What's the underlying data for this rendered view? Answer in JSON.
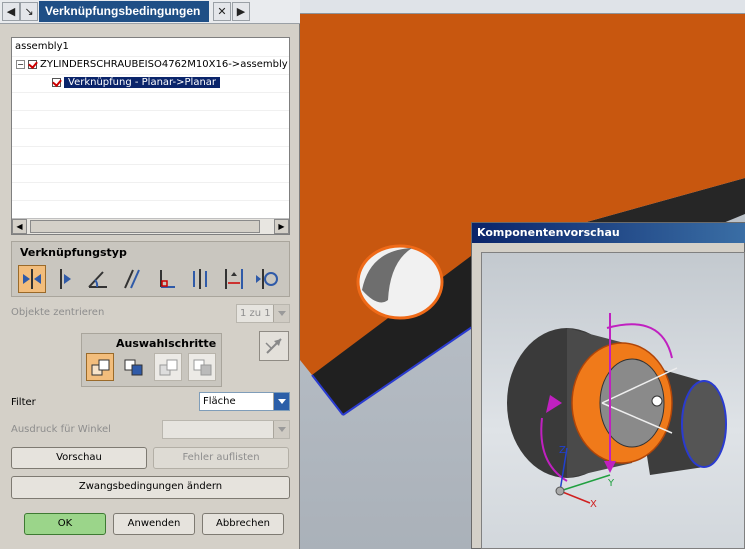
{
  "dialog": {
    "title": "Verknüpfungsbedingungen",
    "tree": {
      "root": "assembly1",
      "child": "ZYLINDERSCHRAUBEISO4762M10X16->assembly",
      "selected": "Verknüpfung - Planar->Planar"
    },
    "constraint_type_label": "Verknüpfungstyp",
    "center_objects_label": "Objekte zentrieren",
    "center_objects_value": "1 zu 1",
    "selection_steps_label": "Auswahlschritte",
    "filter_label": "Filter",
    "filter_value": "Fläche",
    "angle_expr_label": "Ausdruck für Winkel",
    "buttons": {
      "preview": "Vorschau",
      "list_errors": "Fehler auflisten",
      "change_constraints": "Zwangsbedingungen ändern",
      "ok": "OK",
      "apply": "Anwenden",
      "cancel": "Abbrechen"
    }
  },
  "preview_window": {
    "title": "Komponentenvorschau",
    "axis_labels": [
      "Z",
      "Y",
      "X"
    ]
  },
  "colors": {
    "part_orange": "#c8570f",
    "title_blue": "#1f4f86",
    "active_icon": "#f2bd7c",
    "handle_magenta": "#c020c0"
  }
}
